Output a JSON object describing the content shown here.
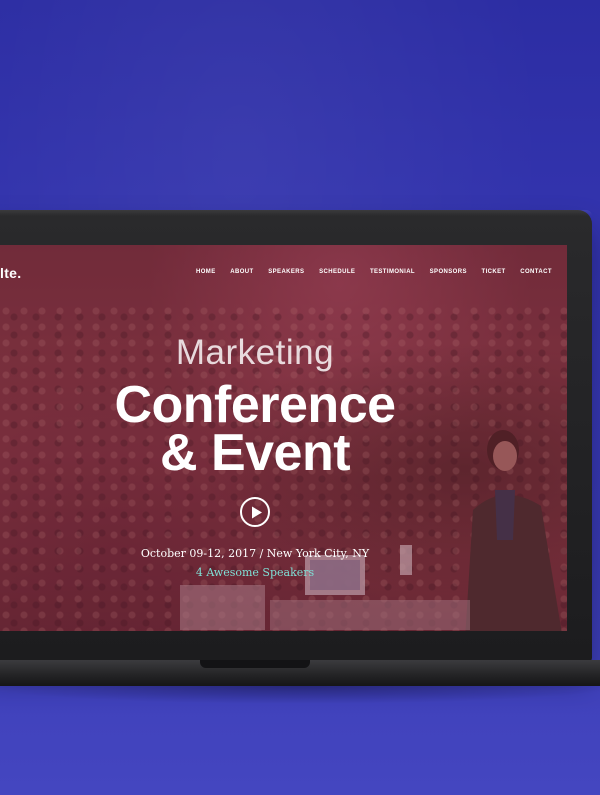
{
  "site": {
    "logo_text": "lte."
  },
  "nav": {
    "items": [
      "HOME",
      "ABOUT",
      "SPEAKERS",
      "SCHEDULE",
      "TESTIMONIAL",
      "SPONSORS",
      "TICKET",
      "CONTACT"
    ]
  },
  "hero": {
    "subtitle": "Marketing",
    "title_line1": "Conference",
    "title_line2": "& Event",
    "date_location": "October 09-12, 2017 / New York City, NY",
    "speakers_text": "4 Awesome Speakers"
  },
  "colors": {
    "page_background": "#3436b0",
    "hero_overlay": "#7a3441",
    "speakers_accent": "#7fe0d6"
  },
  "icons": {
    "play": "play-icon"
  }
}
